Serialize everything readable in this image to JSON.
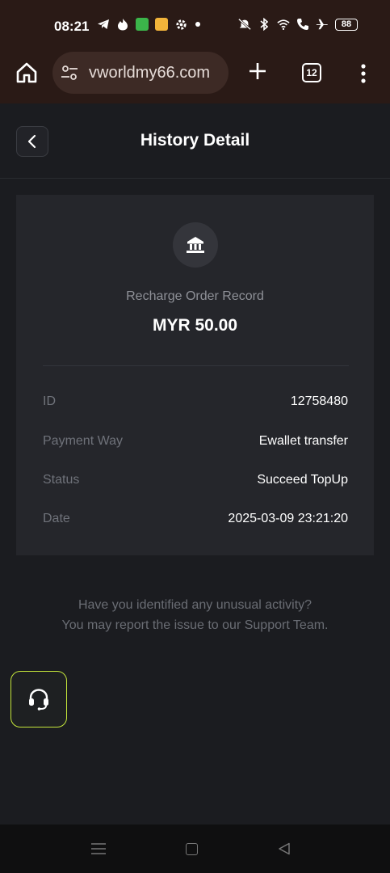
{
  "status_bar": {
    "time": "08:21",
    "left_icons": [
      "telegram-icon",
      "tinder-icon",
      "app-green-icon",
      "app-yellow-icon",
      "settings-icon",
      "notification-dot-icon"
    ],
    "right_icons": [
      "mute-icon",
      "bluetooth-icon",
      "wifi-icon",
      "wifi-call-icon",
      "airplane-icon"
    ],
    "battery": "88"
  },
  "browser": {
    "url": "vworldmy66.com",
    "tab_count": "12",
    "theme_color": "#2a1a16"
  },
  "header": {
    "title": "History Detail"
  },
  "record": {
    "title": "Recharge Order Record",
    "amount": "MYR 50.00",
    "icon": "bank-icon",
    "fields": [
      {
        "label": "ID",
        "value": "12758480"
      },
      {
        "label": "Payment Way",
        "value": "Ewallet transfer"
      },
      {
        "label": "Status",
        "value": "Succeed TopUp"
      },
      {
        "label": "Date",
        "value": "2025-03-09 23:21:20"
      }
    ]
  },
  "help": {
    "line1": "Have you identified any unusual activity?",
    "line2": "You may report the issue to our Support Team."
  },
  "support": {
    "icon": "headset-icon",
    "accent_color": "#c5e63b"
  }
}
